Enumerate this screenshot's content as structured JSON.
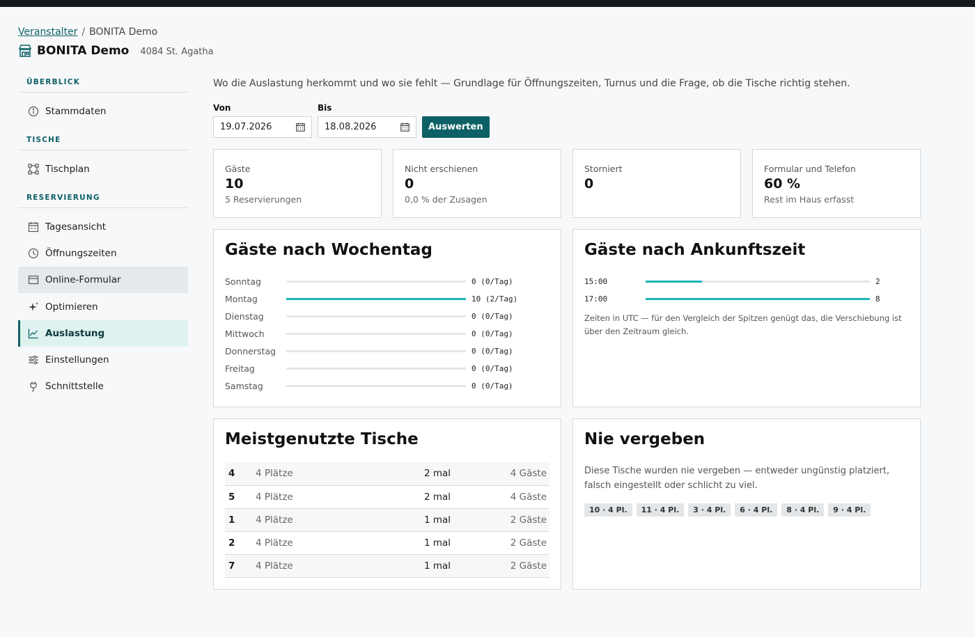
{
  "breadcrumb": {
    "parent": "Veranstalter",
    "separator": "/",
    "current": "BONITA Demo"
  },
  "venue": {
    "name": "BONITA Demo",
    "address": "4084 St. Agatha"
  },
  "sidebar": {
    "sections": [
      {
        "title": "ÜBERBLICK",
        "items": [
          {
            "label": "Stammdaten",
            "icon": "info-icon"
          }
        ]
      },
      {
        "title": "TISCHE",
        "items": [
          {
            "label": "Tischplan",
            "icon": "floorplan-icon"
          }
        ]
      },
      {
        "title": "RESERVIERUNG",
        "items": [
          {
            "label": "Tagesansicht",
            "icon": "calendar-day-icon"
          },
          {
            "label": "Öffnungszeiten",
            "icon": "clock-icon"
          },
          {
            "label": "Online-Formular",
            "icon": "form-icon",
            "state": "hover"
          },
          {
            "label": "Optimieren",
            "icon": "sparkle-icon"
          },
          {
            "label": "Auslastung",
            "icon": "chart-line-icon",
            "state": "active"
          },
          {
            "label": "Einstellungen",
            "icon": "sliders-icon"
          },
          {
            "label": "Schnittstelle",
            "icon": "plug-icon"
          }
        ]
      }
    ]
  },
  "intro": "Wo die Auslastung herkommt und wo sie fehlt — Grundlage für Öffnungszeiten, Turnus und die Frage, ob die Tische richtig stehen.",
  "filters": {
    "from_label": "Von",
    "from_value": "19.07.2026",
    "to_label": "Bis",
    "to_value": "18.08.2026",
    "submit_label": "Auswerten"
  },
  "stats": [
    {
      "label": "Gäste",
      "value": "10",
      "sub": "5 Reservierungen"
    },
    {
      "label": "Nicht erschienen",
      "value": "0",
      "sub": "0,0 % der Zusagen"
    },
    {
      "label": "Storniert",
      "value": "0",
      "sub": ""
    },
    {
      "label": "Formular und Telefon",
      "value": "60 %",
      "sub": "Rest im Haus erfasst"
    }
  ],
  "weekday": {
    "title": "Gäste nach Wochentag",
    "rows": [
      {
        "label": "Sonntag",
        "text": "0 (0/Tag)",
        "fraction": 0
      },
      {
        "label": "Montag",
        "text": "10 (2/Tag)",
        "fraction": 1
      },
      {
        "label": "Dienstag",
        "text": "0 (0/Tag)",
        "fraction": 0
      },
      {
        "label": "Mittwoch",
        "text": "0 (0/Tag)",
        "fraction": 0
      },
      {
        "label": "Donnerstag",
        "text": "0 (0/Tag)",
        "fraction": 0
      },
      {
        "label": "Freitag",
        "text": "0 (0/Tag)",
        "fraction": 0
      },
      {
        "label": "Samstag",
        "text": "0 (0/Tag)",
        "fraction": 0
      }
    ]
  },
  "arrival": {
    "title": "Gäste nach Ankunftszeit",
    "rows": [
      {
        "label": "15:00",
        "text": "2",
        "fraction": 0.25
      },
      {
        "label": "17:00",
        "text": "8",
        "fraction": 1
      }
    ],
    "note": "Zeiten in UTC — für den Vergleich der Spitzen genügt das, die Verschiebung ist über den Zeitraum gleich."
  },
  "top_tables": {
    "title": "Meistgenutzte Tische",
    "rows": [
      {
        "table": "4",
        "seats": "4 Plätze",
        "count": "2 mal",
        "guests": "4 Gäste"
      },
      {
        "table": "5",
        "seats": "4 Plätze",
        "count": "2 mal",
        "guests": "4 Gäste"
      },
      {
        "table": "1",
        "seats": "4 Plätze",
        "count": "1 mal",
        "guests": "2 Gäste"
      },
      {
        "table": "2",
        "seats": "4 Plätze",
        "count": "1 mal",
        "guests": "2 Gäste"
      },
      {
        "table": "7",
        "seats": "4 Plätze",
        "count": "1 mal",
        "guests": "2 Gäste"
      }
    ]
  },
  "never_assigned": {
    "title": "Nie vergeben",
    "description": "Diese Tische wurden nie vergeben — entweder ungünstig platziert, falsch eingestellt oder schlicht zu viel.",
    "chips": [
      "10 · 4 Pl.",
      "11 · 4 Pl.",
      "3 · 4 Pl.",
      "6 · 4 Pl.",
      "8 · 4 Pl.",
      "9 · 4 Pl."
    ]
  },
  "colors": {
    "accent": "#0d6166",
    "bar": "#1bb5b8",
    "active_bg": "#def2f0"
  }
}
